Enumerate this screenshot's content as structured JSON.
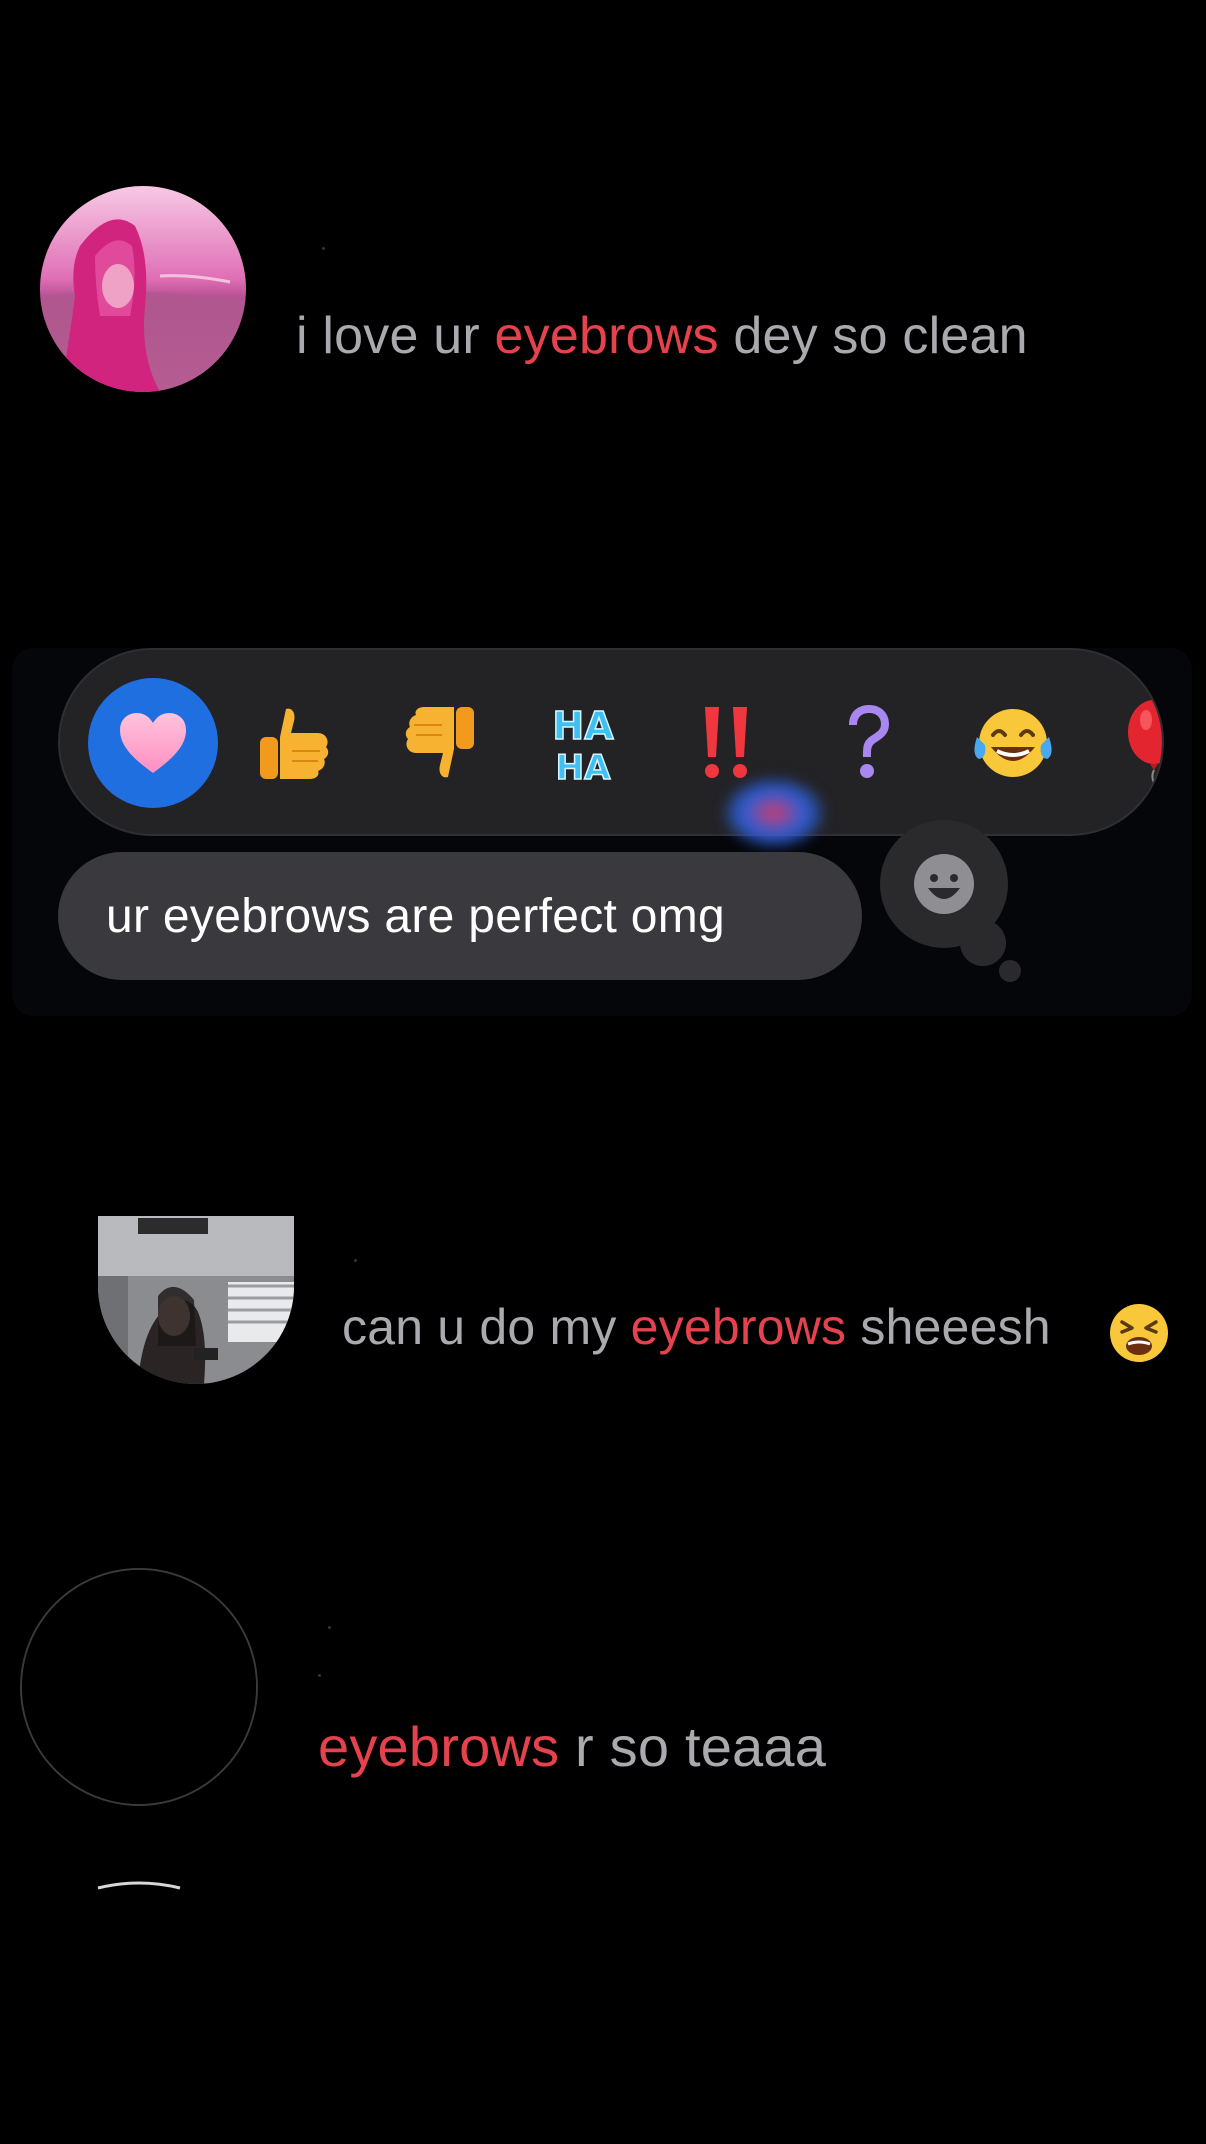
{
  "comments": [
    {
      "prefix": "i love ur ",
      "keyword": "eyebrows",
      "suffix": " dey so clean",
      "avatar_icon": "profile-photo-pink"
    },
    {
      "prefix": "can u do my ",
      "keyword": "eyebrows",
      "suffix": " sheeesh",
      "emoji": "😫",
      "avatar_icon": "profile-photo-gray"
    },
    {
      "prefix": "",
      "keyword": "eyebrows",
      "suffix": " r so teaaa",
      "avatar_icon": "profile-photo-empty"
    }
  ],
  "selected_message": {
    "text": "ur eyebrows are perfect omg"
  },
  "tapback": {
    "reactions": [
      {
        "name": "heart",
        "icon": "heart-icon",
        "selected": true
      },
      {
        "name": "thumbs-up",
        "icon": "thumbs-up-icon"
      },
      {
        "name": "thumbs-down",
        "icon": "thumbs-down-icon"
      },
      {
        "name": "haha",
        "icon": "haha-icon",
        "label_top": "HA",
        "label_bottom": "HA"
      },
      {
        "name": "exclamation",
        "icon": "double-exclamation-icon",
        "label": "‼"
      },
      {
        "name": "question",
        "icon": "question-icon",
        "label": "?"
      },
      {
        "name": "laughing",
        "icon": "tears-of-joy-icon"
      },
      {
        "name": "balloon",
        "icon": "red-balloon-icon"
      }
    ],
    "add_emoji_icon": "smiley-face-icon"
  },
  "colors": {
    "keyword": "#e5424d",
    "text": "#a9a9ae",
    "accent": "#1f6fe0",
    "bubble": "#3a3a3e",
    "bar": "#232326"
  }
}
